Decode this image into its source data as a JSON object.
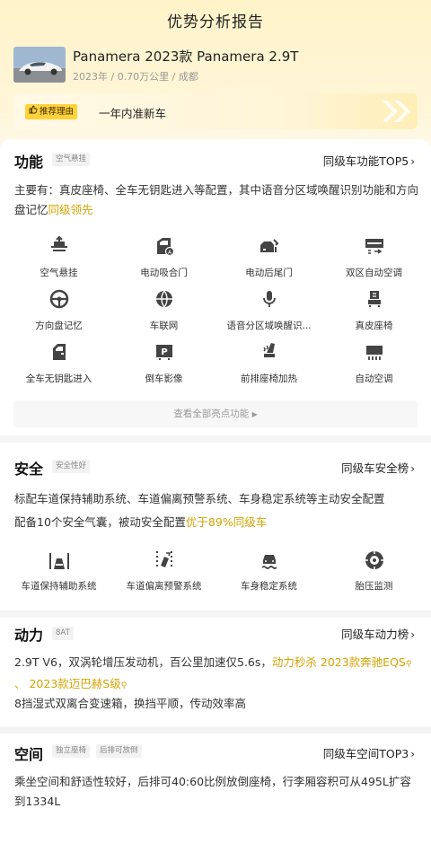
{
  "page_title": "优势分析报告",
  "car": {
    "name": "Panamera 2023款 Panamera 2.9T",
    "meta": "2023年 / 0.70万公里 / 成都"
  },
  "reason": {
    "badge": "推荐理由",
    "text": "一年内准新车"
  },
  "function": {
    "title": "功能",
    "tag": "空气悬挂",
    "link": "同级车功能TOP5",
    "desc_prefix": "主要有：真皮座椅、全车无钥匙进入等配置，其中语音分区域唤醒识别功能和方向盘记忆",
    "desc_highlight": "同级领先",
    "items": [
      {
        "label": "空气悬挂",
        "icon": "air-suspension-icon"
      },
      {
        "label": "电动吸合门",
        "icon": "soft-close-door-icon"
      },
      {
        "label": "电动后尾门",
        "icon": "power-tailgate-icon"
      },
      {
        "label": "双区自动空调",
        "icon": "dual-zone-ac-icon"
      },
      {
        "label": "方向盘记忆",
        "icon": "steering-memory-icon"
      },
      {
        "label": "车联网",
        "icon": "connected-car-icon"
      },
      {
        "label": "语音分区域唤醒识...",
        "icon": "voice-recognition-icon"
      },
      {
        "label": "真皮座椅",
        "icon": "leather-seat-icon"
      },
      {
        "label": "全车无钥匙进入",
        "icon": "keyless-entry-icon"
      },
      {
        "label": "倒车影像",
        "icon": "parking-camera-icon"
      },
      {
        "label": "前排座椅加热",
        "icon": "seat-heating-icon"
      },
      {
        "label": "自动空调",
        "icon": "auto-ac-icon"
      }
    ],
    "more": "查看全部亮点功能"
  },
  "safety": {
    "title": "安全",
    "tag": "安全性好",
    "link": "同级车安全榜",
    "desc1": "标配车道保持辅助系统、车道偏离预警系统、车身稳定系统等主动安全配置",
    "desc2_prefix": "配备10个安全气囊，被动安全配置",
    "desc2_highlight": "优于89%同级车",
    "items": [
      {
        "label": "车道保持辅助系统",
        "icon": "lane-keep-icon"
      },
      {
        "label": "车道偏离预警系统",
        "icon": "lane-departure-icon"
      },
      {
        "label": "车身稳定系统",
        "icon": "stability-control-icon"
      },
      {
        "label": "胎压监测",
        "icon": "tire-pressure-icon"
      }
    ]
  },
  "power": {
    "title": "动力",
    "tag": "8AT",
    "link": "同级车动力榜",
    "desc1_prefix": "2.9T V6，双涡轮增压发动机，百公里加速仅5.6s，",
    "desc1_hl1": "动力秒杀 2023款奔驰EQS",
    "desc1_sep": " 、 ",
    "desc1_hl2": "2023款迈巴赫S级",
    "desc2": "8挡湿式双离合变速箱，换挡平顺，传动效率高"
  },
  "space": {
    "title": "空间",
    "tag1": "独立座椅",
    "tag2": "后排可放倒",
    "link": "同级车空间TOP3",
    "desc": "乘坐空间和舒适性较好，后排可40:60比例放倒座椅，行李厢容积可从495L扩容到1334L"
  },
  "colors": {
    "accent": "#ffd23c",
    "highlight": "#d4a300",
    "icon": "#444444"
  }
}
